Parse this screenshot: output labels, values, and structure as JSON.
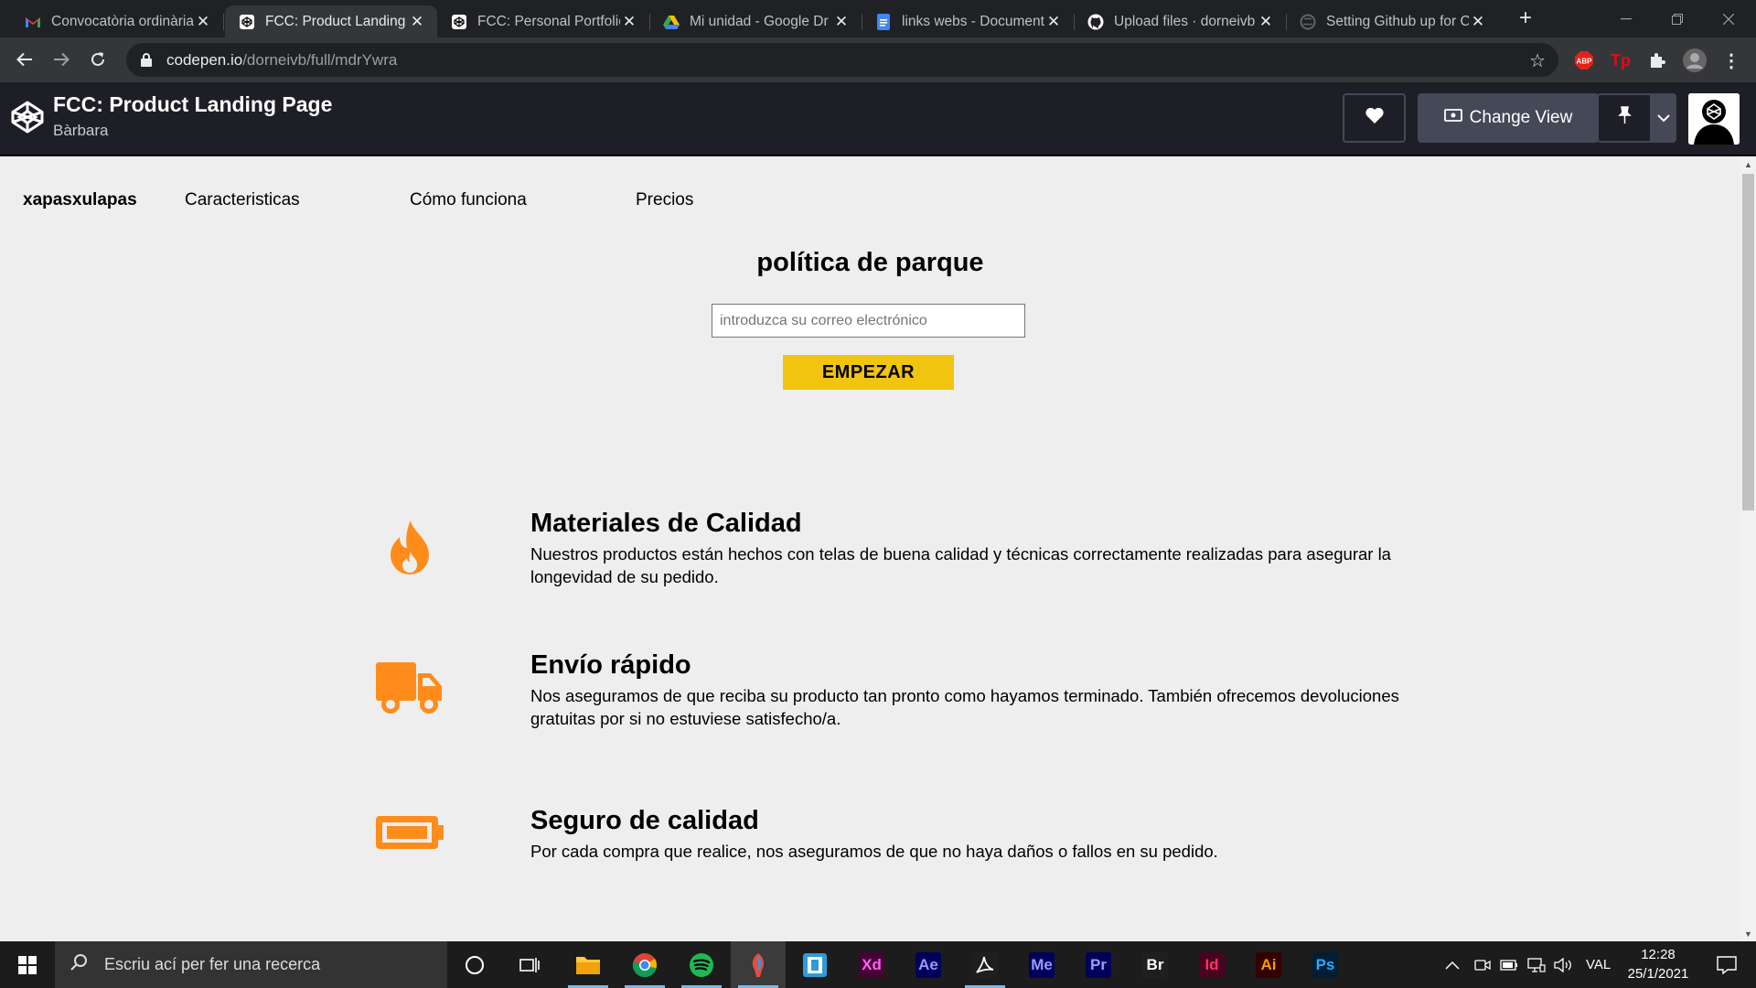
{
  "browser": {
    "tabs": [
      {
        "title": "Convocatòria ordinària",
        "favicon": "gmail-icon",
        "active": false
      },
      {
        "title": "FCC: Product Landing P",
        "favicon": "codepen-icon",
        "active": true
      },
      {
        "title": "FCC: Personal Portfolio",
        "favicon": "codepen-icon",
        "active": false
      },
      {
        "title": "Mi unidad - Google Dr",
        "favicon": "google-drive-icon",
        "active": false
      },
      {
        "title": "links webs - Document",
        "favicon": "google-docs-icon",
        "active": false
      },
      {
        "title": "Upload files · dorneivb",
        "favicon": "github-icon",
        "active": false
      },
      {
        "title": "Setting Github up for C",
        "favicon": "globe-icon",
        "active": false
      }
    ],
    "url_host": "codepen.io",
    "url_path": "/dorneivb/full/mdrYwra",
    "extensions": [
      {
        "label": "ABP",
        "icon": "adblock-plus-icon",
        "color": "#e62117"
      },
      {
        "label": "Tp",
        "icon": "teleparty-icon",
        "color": "#e50914"
      },
      {
        "label": "",
        "icon": "puzzle-extensions-icon",
        "color": "#e8eaed"
      },
      {
        "label": "",
        "icon": "profile-avatar-icon",
        "color": "#888888"
      }
    ]
  },
  "codepen": {
    "title": "FCC: Product Landing Page",
    "author": "Bàrbara",
    "change_view_label": "Change View",
    "accent": "#444857"
  },
  "page": {
    "nav": {
      "brand": "xapasxulapas",
      "links": [
        "Caracteristicas",
        "Cómo funciona",
        "Precios"
      ]
    },
    "hero": {
      "title": "política de parque",
      "email_placeholder": "introduzca su correo electrónico",
      "cta": "EMPEZAR",
      "cta_color": "#f1c40f"
    },
    "features": [
      {
        "icon": "fire-icon",
        "title": "Materiales de Calidad",
        "desc": "Nuestros productos están hechos con telas de buena calidad y técnicas correctamente realizadas para asegurar la longevidad de su pedido."
      },
      {
        "icon": "truck-icon",
        "title": "Envío rápido",
        "desc": "Nos aseguramos de que reciba su producto tan pronto como hayamos terminado. También ofrecemos devoluciones gratuitas por si no estuviese satisfecho/a."
      },
      {
        "icon": "battery-icon",
        "title": "Seguro de calidad",
        "desc": "Por cada compra que realice, nos aseguramos de que no haya daños o fallos en su pedido."
      }
    ],
    "icon_color": "#ff8c1a"
  },
  "taskbar": {
    "search_placeholder": "Escriu ací per fer una recerca",
    "apps": [
      {
        "name": "cortana-icon",
        "label": ""
      },
      {
        "name": "task-view-icon",
        "label": ""
      },
      {
        "name": "file-explorer-icon",
        "label": ""
      },
      {
        "name": "chrome-icon",
        "label": ""
      },
      {
        "name": "spotify-icon",
        "label": ""
      },
      {
        "name": "app-icon",
        "label": ""
      },
      {
        "name": "app-icon",
        "label": ""
      },
      {
        "name": "adobe-xd-icon",
        "label": "Xd"
      },
      {
        "name": "after-effects-icon",
        "label": "Ae"
      },
      {
        "name": "acrobat-icon",
        "label": ""
      },
      {
        "name": "media-encoder-icon",
        "label": "Me"
      },
      {
        "name": "premiere-icon",
        "label": "Pr"
      },
      {
        "name": "bridge-icon",
        "label": "Br"
      },
      {
        "name": "indesign-icon",
        "label": "Id"
      },
      {
        "name": "illustrator-icon",
        "label": "Ai"
      },
      {
        "name": "photoshop-icon",
        "label": "Ps"
      }
    ],
    "language": "VAL",
    "time": "12:28",
    "date": "25/1/2021"
  }
}
